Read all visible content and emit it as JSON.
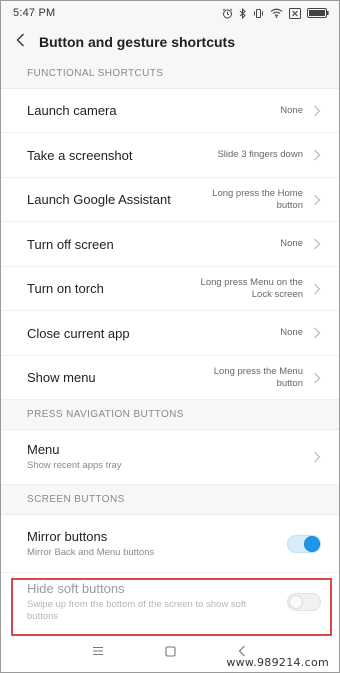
{
  "status_bar": {
    "time": "5:47 PM",
    "icons": [
      "alarm-icon",
      "bluetooth-icon",
      "vibrate-icon",
      "wifi-icon",
      "sim-off-icon",
      "battery-icon"
    ]
  },
  "header": {
    "title": "Button and gesture shortcuts",
    "back_icon": "chevron-left-icon"
  },
  "sections": {
    "functional": {
      "title": "FUNCTIONAL SHORTCUTS",
      "items": [
        {
          "label": "Launch camera",
          "value": "None"
        },
        {
          "label": "Take a screenshot",
          "value": "Slide 3 fingers down"
        },
        {
          "label": "Launch Google Assistant",
          "value": "Long press the Home button"
        },
        {
          "label": "Turn off screen",
          "value": "None"
        },
        {
          "label": "Turn on torch",
          "value": "Long press Menu on the Lock screen"
        },
        {
          "label": "Close current app",
          "value": "None"
        },
        {
          "label": "Show menu",
          "value": "Long press the Menu button"
        }
      ]
    },
    "press_navigation": {
      "title": "PRESS NAVIGATION BUTTONS",
      "items": [
        {
          "label": "Menu",
          "subtitle": "Show recent apps tray"
        }
      ]
    },
    "screen_buttons": {
      "title": "SCREEN BUTTONS",
      "items": [
        {
          "label": "Mirror buttons",
          "subtitle": "Mirror Back and Menu buttons",
          "toggle": true
        },
        {
          "label": "Hide soft buttons",
          "subtitle": "Swipe up from the bottom of the screen to show soft buttons",
          "toggle": false,
          "disabled": true
        }
      ]
    }
  },
  "nav_bar": {
    "icons": [
      "menu-icon",
      "home-icon",
      "back-icon"
    ]
  },
  "watermark": "www.989214.com",
  "colors": {
    "accent": "#1e96e8",
    "highlight": "#d9474a",
    "section_bg": "#f7f7f7"
  }
}
